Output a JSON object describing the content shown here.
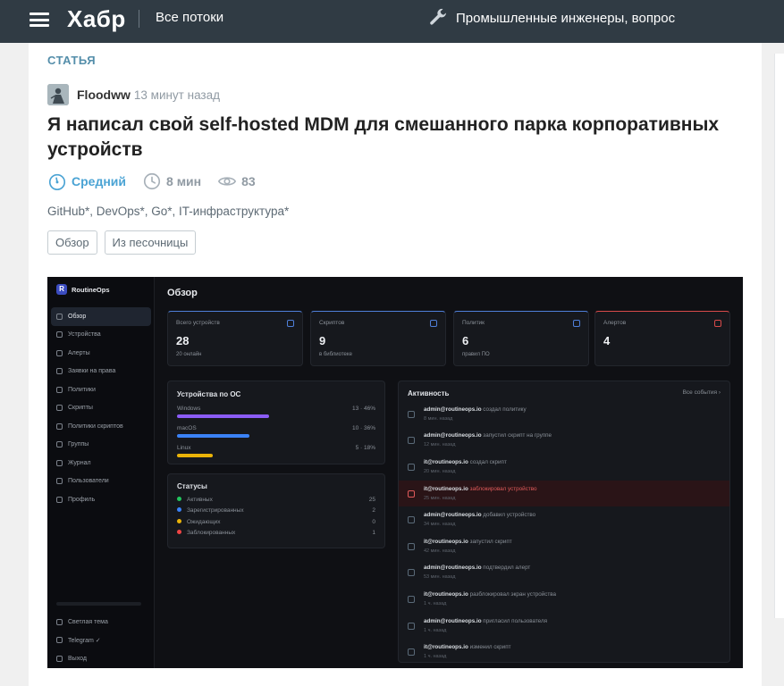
{
  "header": {
    "logo": "Хабр",
    "all_flows": "Все потоки",
    "promo": "Промышленные инженеры, вопрос"
  },
  "article": {
    "type_label": "СТАТЬЯ",
    "author": "Floodww",
    "published": "13 минут назад",
    "title": "Я написал свой self-hosted MDM для смешанного парка корпоративных устройств",
    "difficulty": "Средний",
    "read_time": "8 мин",
    "views": "83",
    "hubs": "GitHub*, DevOps*, Go*, IT-инфраструктура*",
    "tags": [
      "Обзор",
      "Из песочницы"
    ]
  },
  "dashboard": {
    "brand": "RoutineOps",
    "title": "Обзор",
    "nav": [
      "Обзор",
      "Устройства",
      "Алерты",
      "Заявки на права",
      "Политики",
      "Скрипты",
      "Политики скриптов",
      "Группы",
      "Журнал",
      "Пользователи",
      "Профиль"
    ],
    "bottom": [
      "Светлая тема",
      "Telegram ✓",
      "Выход"
    ],
    "stats": [
      {
        "label": "Всего устройств",
        "value": "28",
        "sub": "20 онлайн",
        "accent": "#4f7fd9"
      },
      {
        "label": "Скриптов",
        "value": "9",
        "sub": "в библиотеке",
        "accent": "#4f7fd9"
      },
      {
        "label": "Политик",
        "value": "6",
        "sub": "правил ПО",
        "accent": "#4f7fd9"
      },
      {
        "label": "Алертов",
        "value": "4",
        "sub": "",
        "accent": "#d84a4a"
      }
    ],
    "os_panel": {
      "title": "Устройства по ОС",
      "rows": [
        {
          "name": "Windows",
          "count": "13 · 46%",
          "fill": 0.46,
          "color": "#8b5cf6"
        },
        {
          "name": "macOS",
          "count": "10 · 36%",
          "fill": 0.36,
          "color": "#3b82f6"
        },
        {
          "name": "Linux",
          "count": "5 · 18%",
          "fill": 0.18,
          "color": "#eab308"
        }
      ]
    },
    "status_panel": {
      "title": "Статусы",
      "rows": [
        {
          "name": "Активных",
          "count": "25",
          "color": "#22c55e"
        },
        {
          "name": "Зарегистрированных",
          "count": "2",
          "color": "#3b82f6"
        },
        {
          "name": "Ожидающих",
          "count": "0",
          "color": "#eab308"
        },
        {
          "name": "Заблокированных",
          "count": "1",
          "color": "#ef4444"
        }
      ]
    },
    "activity": {
      "title": "Активность",
      "all": "Все события ›",
      "items": [
        {
          "who": "admin@routineops.io",
          "what": "создал политику",
          "when": "8 мин. назад",
          "alert": false
        },
        {
          "who": "admin@routineops.io",
          "what": "запустил скрипт на группе",
          "when": "12 мин. назад",
          "alert": false
        },
        {
          "who": "it@routineops.io",
          "what": "создал скрипт",
          "when": "20 мин. назад",
          "alert": false
        },
        {
          "who": "it@routineops.io",
          "what": "заблокировал устройство",
          "when": "25 мин. назад",
          "alert": true
        },
        {
          "who": "admin@routineops.io",
          "what": "добавил устройство",
          "when": "34 мин. назад",
          "alert": false
        },
        {
          "who": "it@routineops.io",
          "what": "запустил скрипт",
          "when": "42 мин. назад",
          "alert": false
        },
        {
          "who": "admin@routineops.io",
          "what": "подтвердил алерт",
          "when": "53 мин. назад",
          "alert": false
        },
        {
          "who": "it@routineops.io",
          "what": "разблокировал экран устройства",
          "when": "1 ч. назад",
          "alert": false
        },
        {
          "who": "admin@routineops.io",
          "what": "пригласил пользователя",
          "when": "1 ч. назад",
          "alert": false
        },
        {
          "who": "it@routineops.io",
          "what": "изменил скрипт",
          "when": "1 ч. назад",
          "alert": false
        }
      ]
    }
  }
}
